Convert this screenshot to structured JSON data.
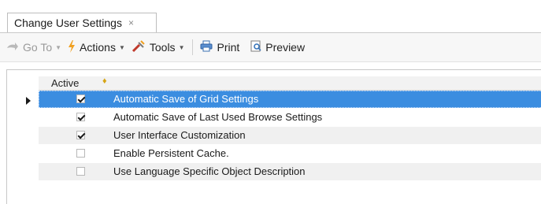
{
  "tab": {
    "title": "Change User Settings",
    "close_glyph": "×"
  },
  "toolbar": {
    "goto_label": "Go To",
    "actions_label": "Actions",
    "tools_label": "Tools",
    "print_label": "Print",
    "preview_label": "Preview",
    "icons": [
      "goto-icon",
      "actions-icon",
      "tools-icon",
      "print-icon",
      "preview-icon"
    ]
  },
  "grid": {
    "column_header": "Active",
    "selected_color": "#3b8de0",
    "rows": [
      {
        "active": true,
        "label": "Automatic Save of Grid Settings"
      },
      {
        "active": true,
        "label": "Automatic Save of Last Used Browse Settings"
      },
      {
        "active": true,
        "label": "User Interface Customization"
      },
      {
        "active": false,
        "label": "Enable Persistent Cache."
      },
      {
        "active": false,
        "label": "Use Language Specific Object Description"
      }
    ]
  }
}
